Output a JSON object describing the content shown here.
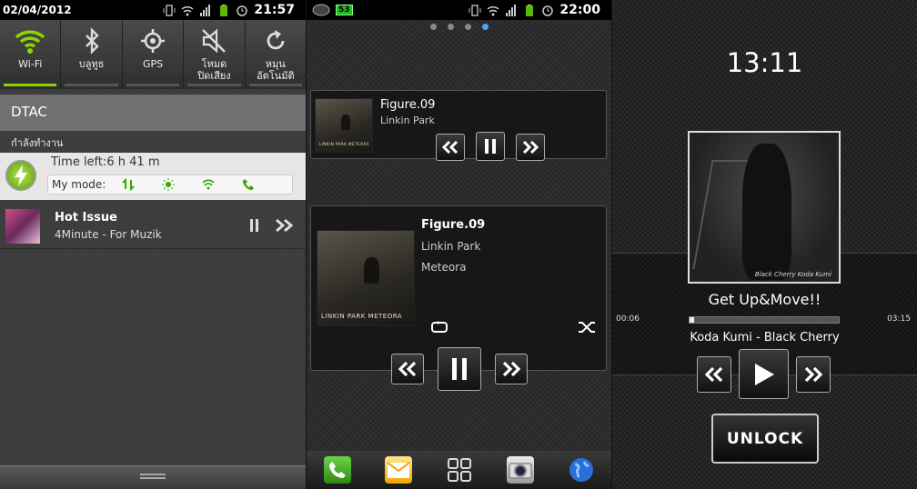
{
  "panel1": {
    "status": {
      "date": "02/04/2012",
      "time": "21:57"
    },
    "quick_settings": [
      {
        "label": "Wi-Fi",
        "icon": "wifi-icon",
        "on": true
      },
      {
        "label": "บลูทูธ",
        "icon": "bluetooth-icon",
        "on": false
      },
      {
        "label": "GPS",
        "icon": "gps-icon",
        "on": false
      },
      {
        "label": "โหมด\nปิดเสียง",
        "icon": "silent-mode-icon",
        "on": false
      },
      {
        "label": "หมุน\nอัตโนมัติ",
        "icon": "auto-rotate-icon",
        "on": false
      }
    ],
    "carrier": "DTAC",
    "ongoing_label": "กำลังทำงาน",
    "battery": {
      "time_left": "Time left:6 h 41 m",
      "mode_label": "My mode:"
    },
    "music": {
      "title": "Hot Issue",
      "subtitle": "4Minute - For Muzik"
    }
  },
  "panel2": {
    "status": {
      "time": "22:00",
      "badge": "53"
    },
    "small_widget": {
      "title": "Figure.09",
      "artist": "Linkin Park"
    },
    "large_widget": {
      "title": "Figure.09",
      "artist": "Linkin Park",
      "album": "Meteora"
    },
    "album_text": "LINKIN PARK METEORA"
  },
  "panel3": {
    "clock": "13:11",
    "song": "Get Up&Move!!",
    "artist_album": "Koda Kumi - Black Cherry",
    "elapsed": "00:06",
    "duration": "03:15",
    "progress": 0.03,
    "album_signature": "Black Cherry  Koda Kumi",
    "unlock_label": "UNLOCK"
  },
  "colors": {
    "accent_green": "#8dd400",
    "page_dot": "#4aa3ff"
  }
}
